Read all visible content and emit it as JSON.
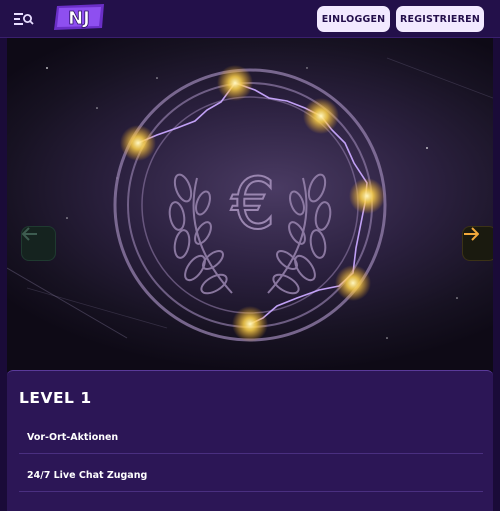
{
  "header": {
    "logo_text": "NJ",
    "login_label": "EINLOGGEN",
    "register_label": "REGISTRIEREN"
  },
  "slider": {
    "coin_symbol": "€",
    "prev_icon": "arrow-left-icon",
    "next_icon": "arrow-right-icon"
  },
  "level": {
    "title": "LEVEL 1",
    "benefits": [
      "Vor-Ort-Aktionen",
      "24/7 Live Chat Zugang"
    ]
  },
  "colors": {
    "header_bg": "#23104a",
    "button_bg": "#f2e9ff",
    "card_bg": "#2c1656",
    "lightning": "#c9a8ff",
    "star": "#ffe680",
    "next_arrow": "#f2a93b"
  }
}
